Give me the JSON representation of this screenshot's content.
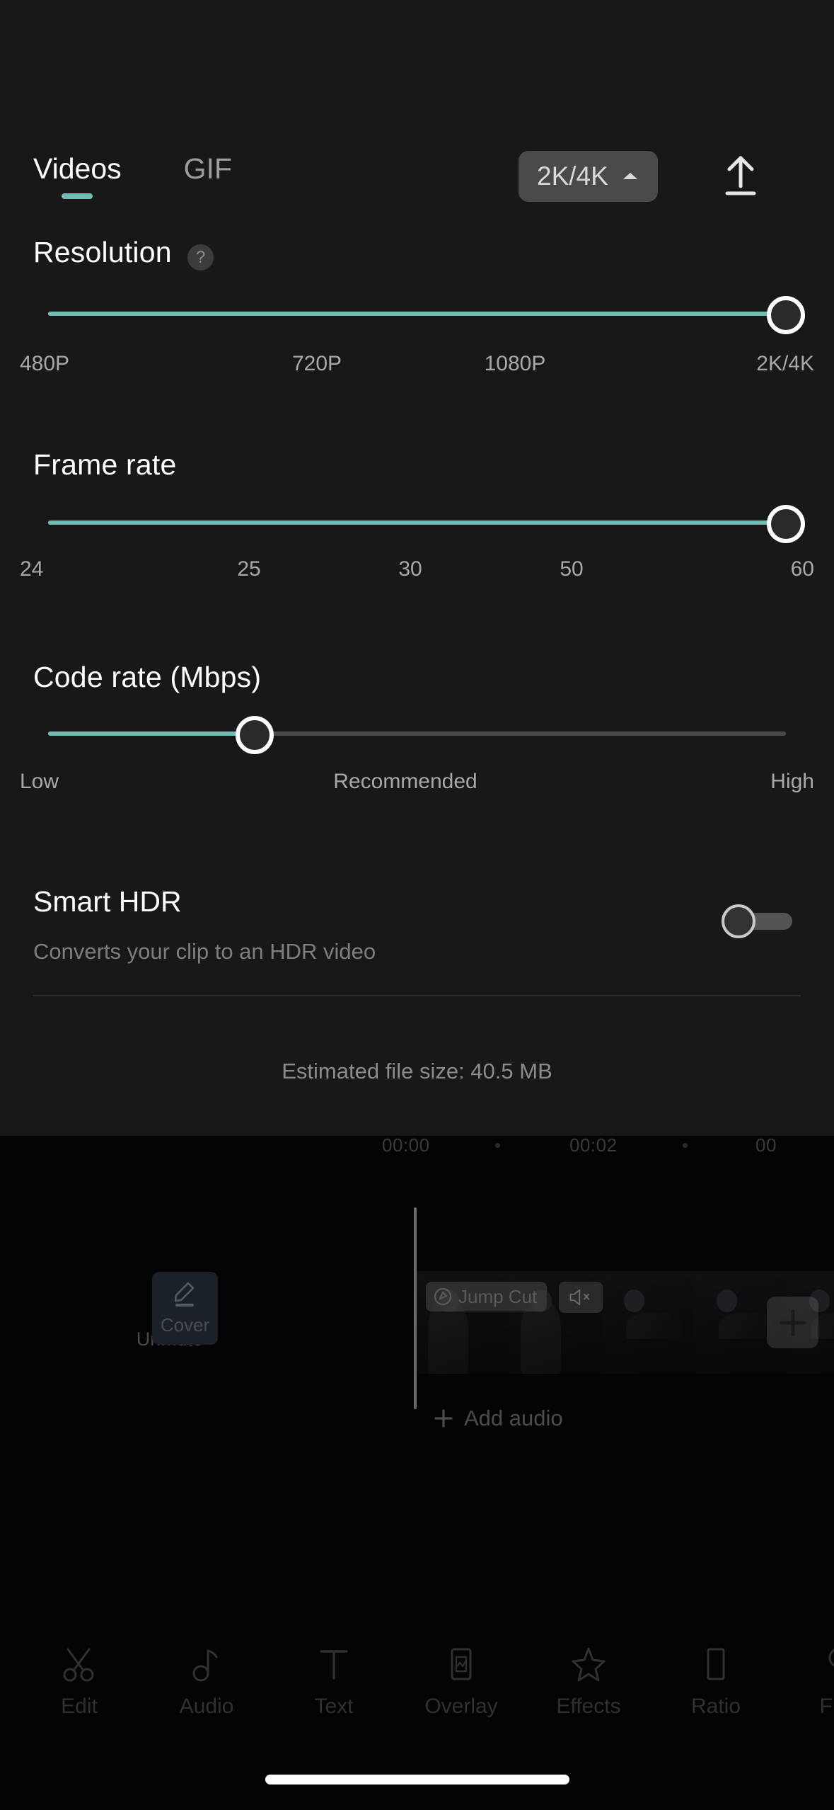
{
  "sheet": {
    "tabs": [
      {
        "label": "Videos",
        "active": true
      },
      {
        "label": "GIF",
        "active": false
      }
    ],
    "quality_pill": {
      "label": "2K/4K",
      "icon": "chevron-up-icon"
    },
    "export_icon": "upload-icon",
    "resolution": {
      "title": "Resolution",
      "help_icon": "?",
      "ticks": [
        "480P",
        "720P",
        "1080P",
        "2K/4K"
      ],
      "value_percent": 100,
      "selected": "2K/4K"
    },
    "frame_rate": {
      "title": "Frame rate",
      "ticks": [
        "24",
        "25",
        "30",
        "50",
        "60"
      ],
      "value_percent": 100,
      "selected": "60"
    },
    "code_rate": {
      "title": "Code rate (Mbps)",
      "ticks": [
        "Low",
        "Recommended",
        "High"
      ],
      "value_percent": 32,
      "selected": "Recommended"
    },
    "smart_hdr": {
      "title": "Smart HDR",
      "subtitle": "Converts your clip to an HDR video",
      "enabled": false
    },
    "estimated_file_size": "Estimated file size: 40.5 MB"
  },
  "editor": {
    "ruler_ticks": [
      "00:00",
      "00:02",
      "00"
    ],
    "unmute": {
      "label": "Unmute",
      "icon": "speaker-muted-icon"
    },
    "cover": {
      "label": "Cover",
      "icon": "pen-icon"
    },
    "jump_cut_badge": {
      "label": "Jump Cut",
      "icon": "speed-icon"
    },
    "clip_mute_icon": "speaker-muted-icon",
    "add_clip_icon": "plus-icon",
    "add_audio": {
      "label": "Add audio",
      "icon": "plus-icon"
    }
  },
  "toolbar": {
    "items": [
      {
        "label": "Edit",
        "icon": "scissors-icon"
      },
      {
        "label": "Audio",
        "icon": "music-note-icon"
      },
      {
        "label": "Text",
        "icon": "text-t-icon"
      },
      {
        "label": "Overlay",
        "icon": "overlay-icon"
      },
      {
        "label": "Effects",
        "icon": "star-sparkle-icon"
      },
      {
        "label": "Ratio",
        "icon": "rectangle-icon"
      },
      {
        "label": "Filter",
        "icon": "circles-overlap-icon"
      }
    ]
  },
  "colors": {
    "accent_teal": "#6FBDB4",
    "sheet_bg": "#181818",
    "app_bg": "#030303",
    "pill_bg": "#4A4A4A"
  }
}
